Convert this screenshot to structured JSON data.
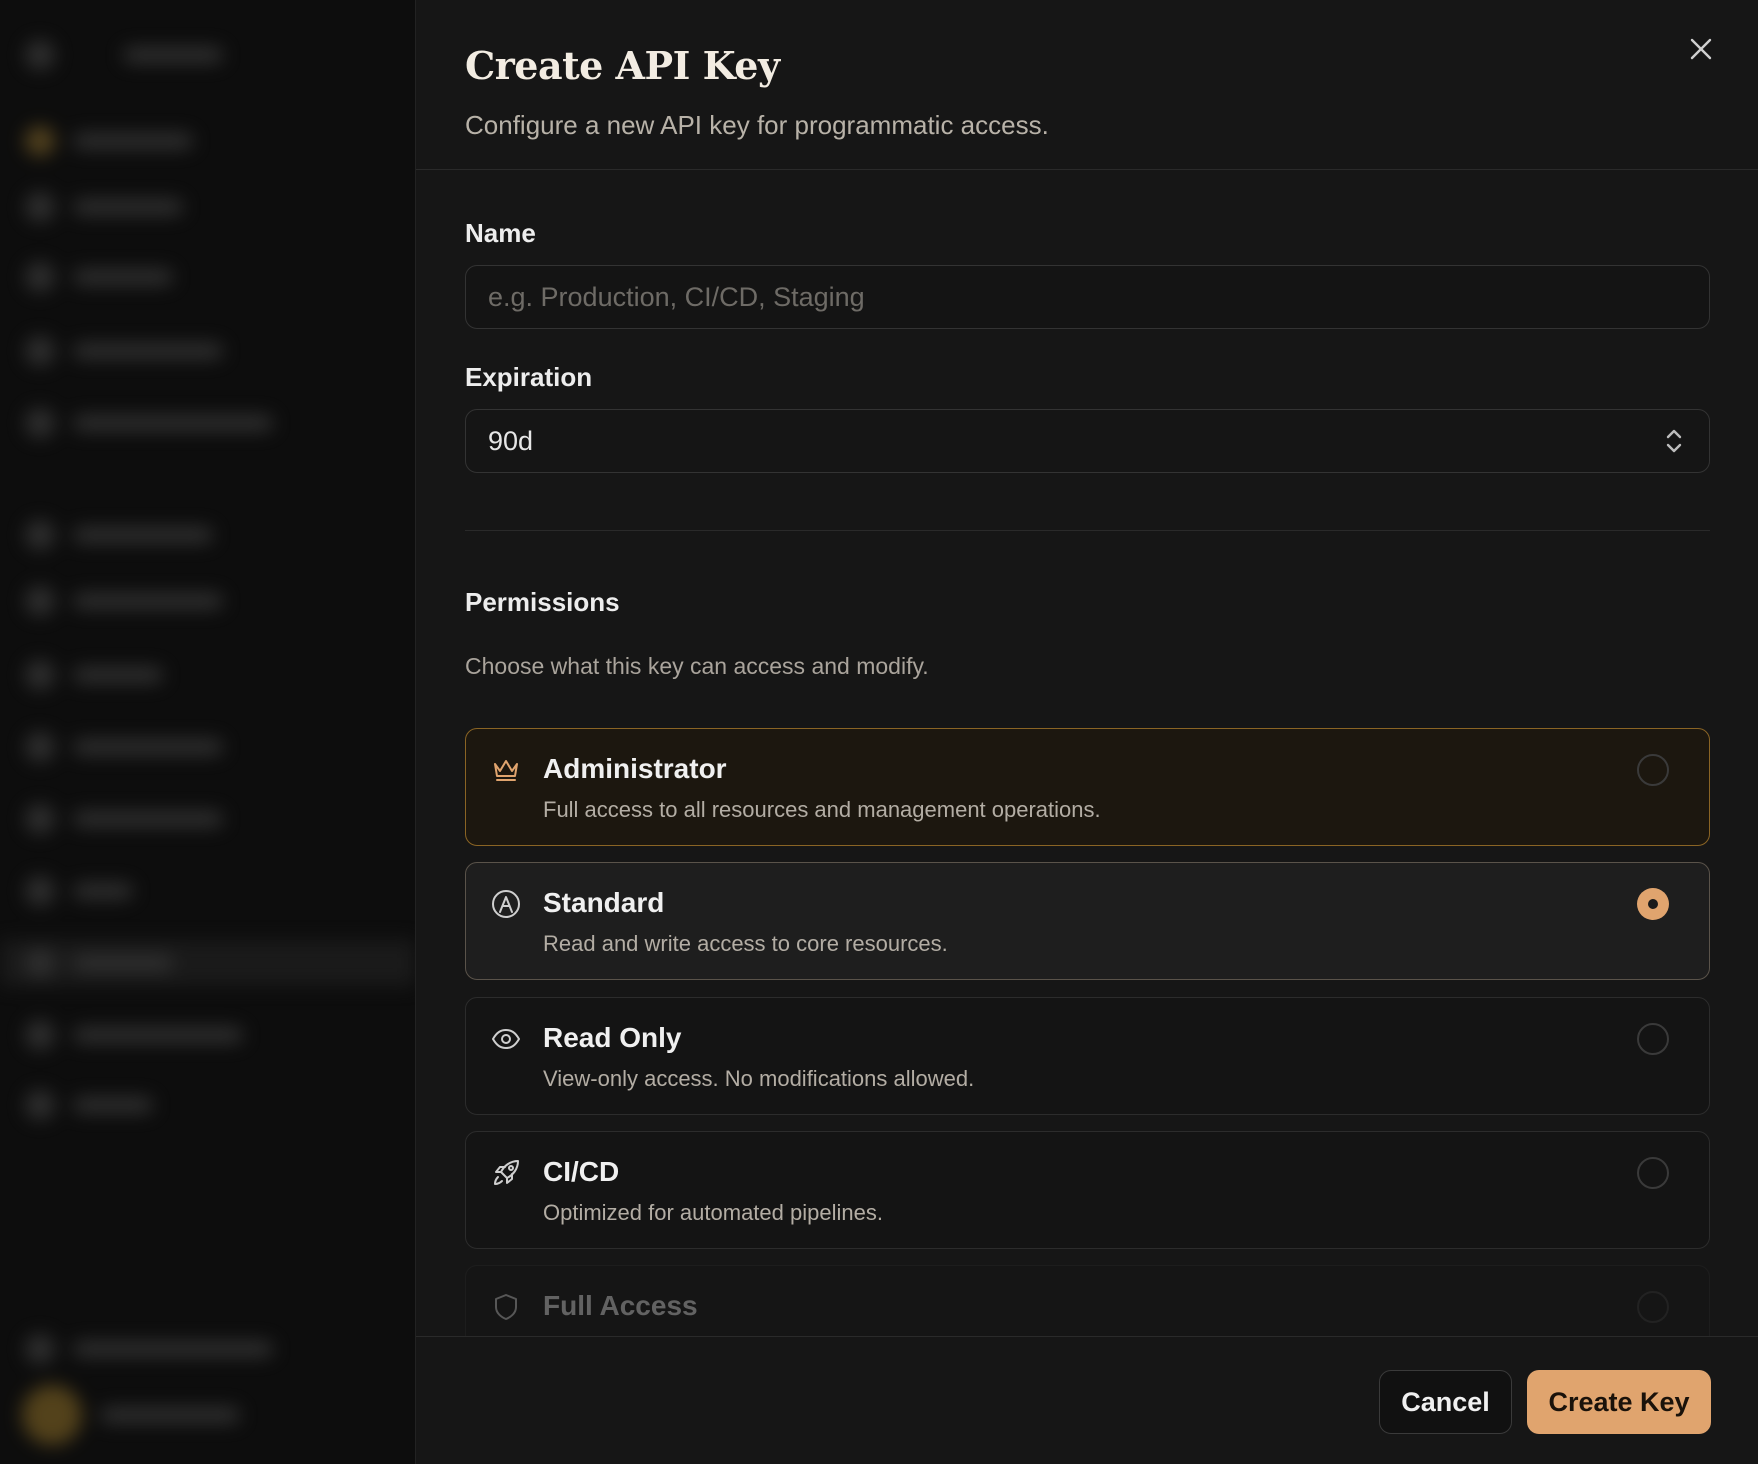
{
  "dialog": {
    "title": "Create API Key",
    "subtitle": "Configure a new API key for programmatic access."
  },
  "form": {
    "name_label": "Name",
    "name_placeholder": "e.g. Production, CI/CD, Staging",
    "name_value": "",
    "expiration_label": "Expiration",
    "expiration_value": "90d"
  },
  "permissions": {
    "title": "Permissions",
    "description": "Choose what this key can access and modify.",
    "selected": "Standard",
    "options": [
      {
        "icon": "crown-icon",
        "title": "Administrator",
        "description": "Full access to all resources and management operations."
      },
      {
        "icon": "user-circle-icon",
        "title": "Standard",
        "description": "Read and write access to core resources."
      },
      {
        "icon": "eye-icon",
        "title": "Read Only",
        "description": "View-only access. No modifications allowed."
      },
      {
        "icon": "rocket-icon",
        "title": "CI/CD",
        "description": "Optimized for automated pipelines."
      },
      {
        "icon": "shield-icon",
        "title": "Full Access",
        "description": ""
      }
    ]
  },
  "footer": {
    "cancel_label": "Cancel",
    "create_label": "Create Key"
  },
  "colors": {
    "accent": "#e0a46e",
    "admin_border": "#8a6424",
    "background": "#161616"
  }
}
